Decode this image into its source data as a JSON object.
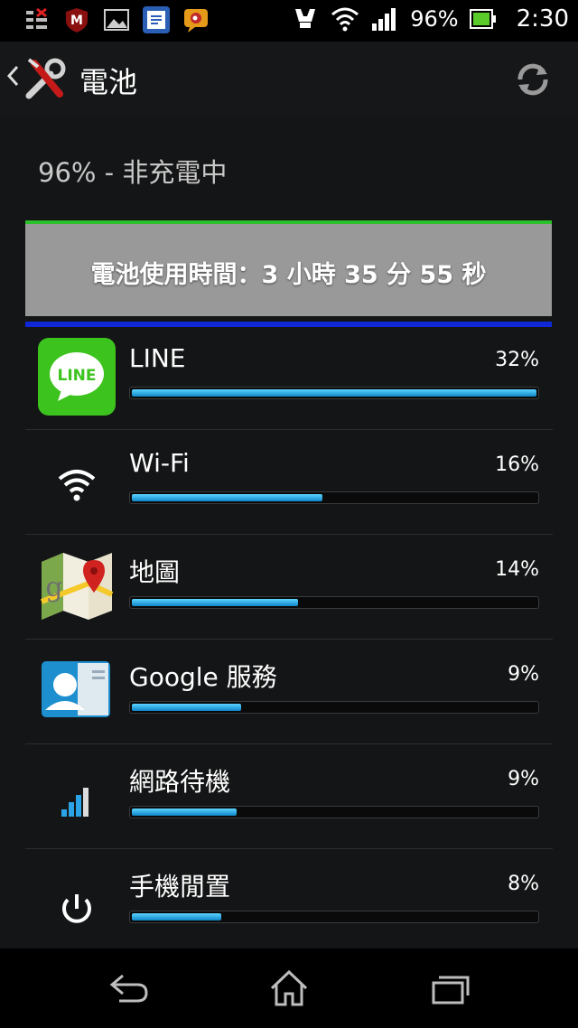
{
  "status_bar": {
    "battery_percent": "96%",
    "time": "2:30"
  },
  "header": {
    "title": "電池"
  },
  "battery_status": "96% - 非充電中",
  "usage_banner": "電池使用時間：3 小時 35 分 55 秒",
  "usage_items": [
    {
      "name": "LINE",
      "percent": "32%",
      "level": 1.0,
      "icon": "line-icon"
    },
    {
      "name": "Wi-Fi",
      "percent": "16%",
      "level": 0.47,
      "icon": "wifi-icon"
    },
    {
      "name": "地圖",
      "percent": "14%",
      "level": 0.41,
      "icon": "maps-icon"
    },
    {
      "name": "Google 服務",
      "percent": "9%",
      "level": 0.27,
      "icon": "contacts-icon"
    },
    {
      "name": "網路待機",
      "percent": "9%",
      "level": 0.26,
      "icon": "cell-signal-icon"
    },
    {
      "name": "手機閒置",
      "percent": "8%",
      "level": 0.22,
      "icon": "power-icon"
    }
  ],
  "colors": {
    "accent": "#2aa4e6",
    "green_line": "#2bbf29",
    "blue_line": "#1028d8"
  }
}
